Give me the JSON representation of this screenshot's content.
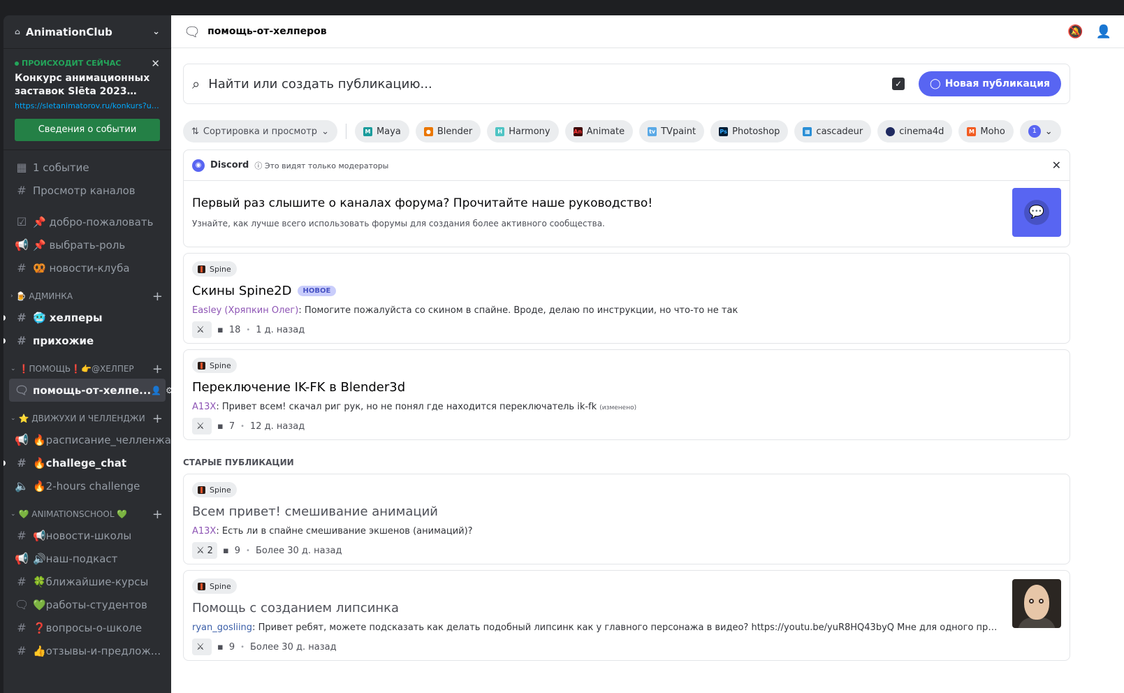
{
  "server": {
    "name": "AnimationClub"
  },
  "event": {
    "live_label": "ПРОИСХОДИТ СЕЙЧАС",
    "title": "Конкурс анимационных заставок Slēta 2023…",
    "link": "https://sletanimatorov.ru/konkurs?utm_source=discord",
    "button": "Сведения о событии"
  },
  "nav": {
    "events": "1 событие",
    "browse": "Просмотр каналов",
    "welcome": "📌 добро-пожаловать",
    "role": "📌 выбрать-роль",
    "club_news": "🥨 новости-клуба",
    "cat_admin": "🍺 АДМИНКА",
    "helpers": "🥶 хелперы",
    "similar": "прихожие",
    "cat_help": "❗ПОМОЩЬ❗👉@ХЕЛПЕР",
    "help_channel": "помощь-от-хелпе...",
    "cat_challenges": "⭐ ДВИЖУХИ И ЧЕЛЛЕНДЖИ",
    "schedule": "🔥расписание_челленжа",
    "challenge_chat": "🔥challege_chat",
    "two_hours": "🔥2-hours challenge",
    "cat_school": "💚 ANIMATIONSCHOOL 💚",
    "school_news": "📢новости-школы",
    "podcast": "🔊наш-подкаст",
    "courses": "🍀ближайшие-курсы",
    "students": "💚работы-студентов",
    "school_q": "❓вопросы-о-школе",
    "reviews": "👍отзывы-и-предлож..."
  },
  "header": {
    "channel": "помощь-от-хелперов"
  },
  "search": {
    "placeholder": "Найти или создать публикацию...",
    "new_post": "Новая публикация"
  },
  "filters": {
    "sort": "Сортировка и просмотр",
    "tags": [
      "Maya",
      "Blender",
      "Harmony",
      "Animate",
      "TVpaint",
      "Photoshop",
      "cascadeur",
      "cinema4d",
      "Moho"
    ],
    "count": "1"
  },
  "notice": {
    "brand": "Discord",
    "visibility": "Это видят только модераторы",
    "title": "Первый раз слышите о каналах форума? Прочитайте наше руководство!",
    "subtitle": "Узнайте, как лучше всего использовать форумы для создания более активного сообщества."
  },
  "posts": [
    {
      "tag": "Spine",
      "title": "Скины Spine2D",
      "badge": "НОВОЕ",
      "author": "Easley (Хряпкин Олег)",
      "preview": ": Помогите пожалуйста со скином в спайне. Вроде, делаю по инструкции, но что-то не так",
      "reactions": "",
      "comments": "18",
      "time": "1 д. назад"
    },
    {
      "tag": "Spine",
      "title": "Переключение IK-FK в Blender3d",
      "author": "A13X",
      "preview": ": Привет всем! скачал риг рук, но не понял где находится переключатель ik-fk",
      "edited": "(изменено)",
      "reactions": "",
      "comments": "7",
      "time": "12 д. назад"
    }
  ],
  "old_section": "СТАРЫЕ ПУБЛИКАЦИИ",
  "old_posts": [
    {
      "tag": "Spine",
      "title": "Всем привет! смешивание анимаций",
      "author": "A13X",
      "preview": ": Есть ли в спайне смешивание экшенов (анимаций)?",
      "reactions": "2",
      "comments": "9",
      "time": "Более 30 д. назад"
    },
    {
      "tag": "Spine",
      "title": "Помощь с созданием липсинка",
      "author": "ryan_gosliing",
      "preview": ": Привет ребят, можете подсказать как делать подобный липсинк как у главного персонажа в видео? https://youtu.be/yuR8HQ43byQ Мне для одного проекта было бы клево д...",
      "reactions": "",
      "comments": "9",
      "time": "Более 30 д. назад"
    }
  ],
  "colors": {
    "accent": "#5865f2",
    "live": "#23a55a",
    "event_button": "#248046"
  }
}
